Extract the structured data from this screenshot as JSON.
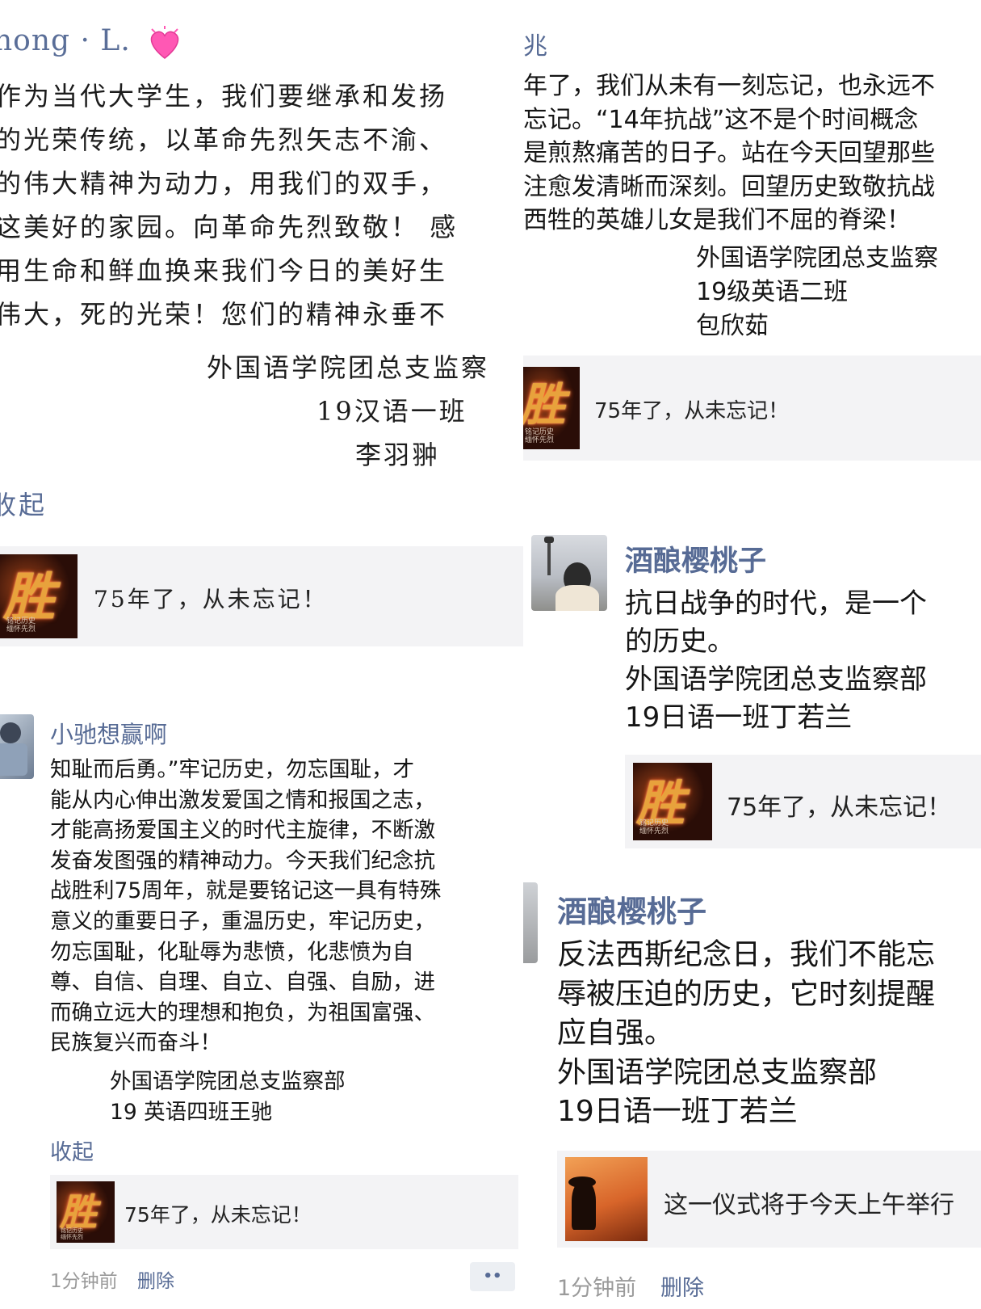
{
  "left": {
    "post1": {
      "name": "hong · L.",
      "lines": [
        "作为当代大学生，我们要继承和发扬",
        "的光荣传统，以革命先烈矢志不渝、",
        "的伟大精神为动力，用我们的双手，",
        "这美好的家园。向革命先烈致敬！ 感",
        "用生命和鲜血换来我们今日的美好生",
        "伟大，死的光荣！您们的精神永垂不"
      ],
      "signature": [
        "外国语学院团总支监察",
        "19汉语一班",
        "李羽翀"
      ],
      "collapse": "收起",
      "card_text": "75年了，从未忘记！"
    },
    "post2": {
      "name": "小驰想赢啊",
      "lines": [
        "知耻而后勇。”牢记历史，勿忘国耻，才",
        "能从内心伸出激发爱国之情和报国之志，",
        "才能高扬爱国主义的时代主旋律，不断激",
        "发奋发图强的精神动力。今天我们纪念抗",
        "战胜利75周年，就是要铭记这一具有特殊",
        "意义的重要日子，重温历史，牢记历史，",
        "勿忘国耻，化耻辱为悲愤，化悲愤为自",
        "尊、自信、自理、自立、自强、自励，进",
        "而确立远大的理想和抱负，为祖国富强、",
        "民族复兴而奋斗！"
      ],
      "signature": [
        "外国语学院团总支监察部",
        "19 英语四班王驰"
      ],
      "collapse": "收起",
      "card_text": "75年了，从未忘记！",
      "time": "1分钟前",
      "delete": "删除",
      "more": "••"
    }
  },
  "right": {
    "post1": {
      "name": "兆",
      "lines": [
        "年了，我们从未有一刻忘记，也永远不",
        "忘记。“14年抗战”这不是个时间概念",
        "是煎熬痛苦的日子。站在今天回望那些",
        "注愈发清晰而深刻。回望历史致敬抗战",
        "西牲的英雄儿女是我们不屈的脊梁！"
      ],
      "signature": [
        "外国语学院团总支监察",
        "19级英语二班",
        "包欣茹"
      ],
      "card_text": "75年了，从未忘记！"
    },
    "post2": {
      "name": "酒酿樱桃子",
      "lines": [
        "抗日战争的时代，是一个",
        "的历史。",
        "外国语学院团总支监察部",
        "19日语一班丁若兰"
      ],
      "card_text": "75年了，从未忘记！"
    },
    "post3": {
      "name": "酒酿樱桃子",
      "lines": [
        "反法西斯纪念日，我们不能忘",
        "辱被压迫的历史，它时刻提醒",
        "应自强。",
        "外国语学院团总支监察部",
        "19日语一班丁若兰"
      ],
      "card_text": "这一仪式将于今天上午举行",
      "time": "1分钟前",
      "delete": "删除"
    }
  },
  "thumb": {
    "glyph": "胜",
    "tag_line1": "铭记历史",
    "tag_line2": "缅怀先烈"
  },
  "colors": {
    "link": "#576b95",
    "card": "#f3f3f5",
    "meta": "#9a9a9a"
  }
}
